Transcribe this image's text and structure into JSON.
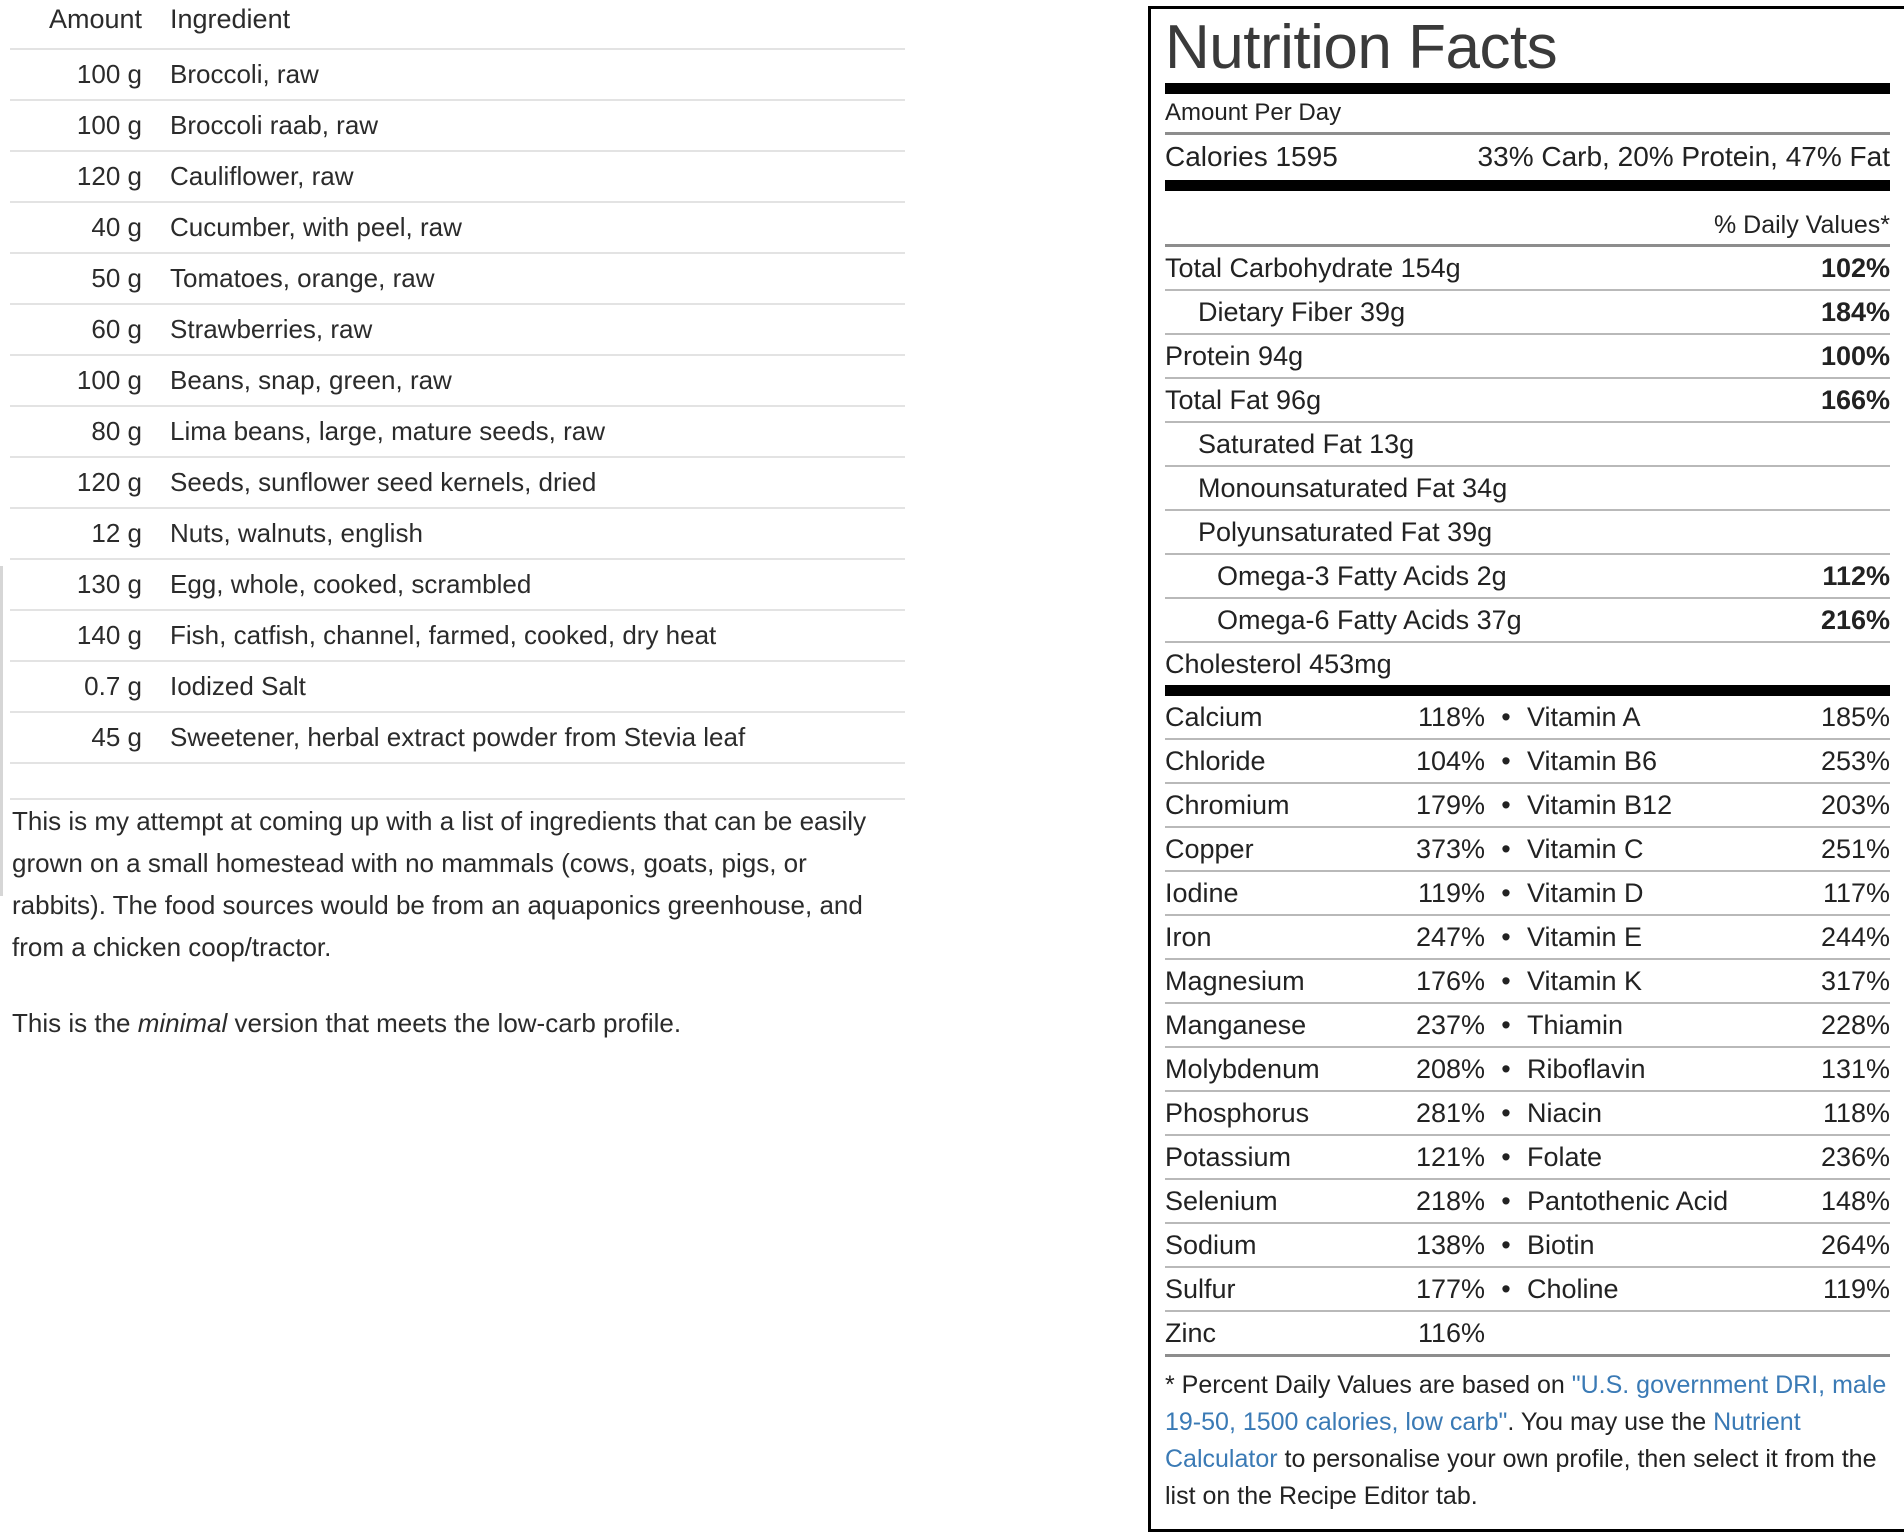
{
  "ingredients_table": {
    "headers": {
      "amount": "Amount",
      "ingredient": "Ingredient"
    },
    "rows": [
      {
        "amount": "100 g",
        "ingredient": "Broccoli, raw"
      },
      {
        "amount": "100 g",
        "ingredient": "Broccoli raab, raw"
      },
      {
        "amount": "120 g",
        "ingredient": "Cauliflower, raw"
      },
      {
        "amount": "40 g",
        "ingredient": "Cucumber, with peel, raw"
      },
      {
        "amount": "50 g",
        "ingredient": "Tomatoes, orange, raw"
      },
      {
        "amount": "60 g",
        "ingredient": "Strawberries, raw"
      },
      {
        "amount": "100 g",
        "ingredient": "Beans, snap, green, raw"
      },
      {
        "amount": "80 g",
        "ingredient": "Lima beans, large, mature seeds, raw"
      },
      {
        "amount": "120 g",
        "ingredient": "Seeds, sunflower seed kernels, dried"
      },
      {
        "amount": "12 g",
        "ingredient": "Nuts, walnuts, english"
      },
      {
        "amount": "130 g",
        "ingredient": "Egg, whole, cooked, scrambled"
      },
      {
        "amount": "140 g",
        "ingredient": "Fish, catfish, channel, farmed, cooked, dry heat"
      },
      {
        "amount": "0.7 g",
        "ingredient": "Iodized Salt"
      },
      {
        "amount": "45 g",
        "ingredient": "Sweetener, herbal extract powder from Stevia leaf"
      }
    ]
  },
  "notes": {
    "paragraph1": "This is my attempt at coming up with a list of ingredients that can be easily grown on a small homestead with no mammals (cows, goats, pigs, or rabbits). The food sources would be from an aquaponics greenhouse, and from a chicken coop/tractor.",
    "paragraph2_before": "This is the ",
    "paragraph2_emphasis": "minimal",
    "paragraph2_after": " version that meets the low-carb profile."
  },
  "nutrition_facts": {
    "title": "Nutrition Facts",
    "amount_per_label": "Amount Per Day",
    "calories_label": "Calories",
    "calories_value": "1595",
    "macro_split": "33% Carb, 20% Protein, 47% Fat",
    "daily_values_header": "% Daily Values*",
    "nutrients": [
      {
        "label": "Total Carbohydrate 154g",
        "pct": "102%",
        "indent": 0
      },
      {
        "label": "Dietary Fiber 39g",
        "pct": "184%",
        "indent": 1
      },
      {
        "label": "Protein 94g",
        "pct": "100%",
        "indent": 0
      },
      {
        "label": "Total Fat 96g",
        "pct": "166%",
        "indent": 0
      },
      {
        "label": "Saturated Fat 13g",
        "pct": "",
        "indent": 1
      },
      {
        "label": "Monounsaturated Fat 34g",
        "pct": "",
        "indent": 1
      },
      {
        "label": "Polyunsaturated Fat 39g",
        "pct": "",
        "indent": 1
      },
      {
        "label": "Omega-3 Fatty Acids 2g",
        "pct": "112%",
        "indent": 2
      },
      {
        "label": "Omega-6 Fatty Acids 37g",
        "pct": "216%",
        "indent": 2
      },
      {
        "label": "Cholesterol 453mg",
        "pct": "",
        "indent": 0
      }
    ],
    "separator_dot": "•",
    "micronutrients": [
      {
        "name": "Calcium",
        "pct": "118%",
        "name2": "Vitamin A",
        "pct2": "185%"
      },
      {
        "name": "Chloride",
        "pct": "104%",
        "name2": "Vitamin B6",
        "pct2": "253%"
      },
      {
        "name": "Chromium",
        "pct": "179%",
        "name2": "Vitamin B12",
        "pct2": "203%"
      },
      {
        "name": "Copper",
        "pct": "373%",
        "name2": "Vitamin C",
        "pct2": "251%"
      },
      {
        "name": "Iodine",
        "pct": "119%",
        "name2": "Vitamin D",
        "pct2": "117%"
      },
      {
        "name": "Iron",
        "pct": "247%",
        "name2": "Vitamin E",
        "pct2": "244%"
      },
      {
        "name": "Magnesium",
        "pct": "176%",
        "name2": "Vitamin K",
        "pct2": "317%"
      },
      {
        "name": "Manganese",
        "pct": "237%",
        "name2": "Thiamin",
        "pct2": "228%"
      },
      {
        "name": "Molybdenum",
        "pct": "208%",
        "name2": "Riboflavin",
        "pct2": "131%"
      },
      {
        "name": "Phosphorus",
        "pct": "281%",
        "name2": "Niacin",
        "pct2": "118%"
      },
      {
        "name": "Potassium",
        "pct": "121%",
        "name2": "Folate",
        "pct2": "236%"
      },
      {
        "name": "Selenium",
        "pct": "218%",
        "name2": "Pantothenic Acid",
        "pct2": "148%"
      },
      {
        "name": "Sodium",
        "pct": "138%",
        "name2": "Biotin",
        "pct2": "264%"
      },
      {
        "name": "Sulfur",
        "pct": "177%",
        "name2": "Choline",
        "pct2": "119%"
      },
      {
        "name": "Zinc",
        "pct": "116%",
        "name2": "",
        "pct2": ""
      }
    ],
    "footnote": {
      "part1": "* Percent Daily Values are based on ",
      "link1": "\"U.S. government DRI, male 19-50, 1500 calories, low carb\"",
      "part2": ". You may use the ",
      "link2": "Nutrient Calculator",
      "part3": " to personalise your own profile, then select it from the list on the Recipe Editor tab."
    },
    "link_color": "#3a7ab5"
  }
}
